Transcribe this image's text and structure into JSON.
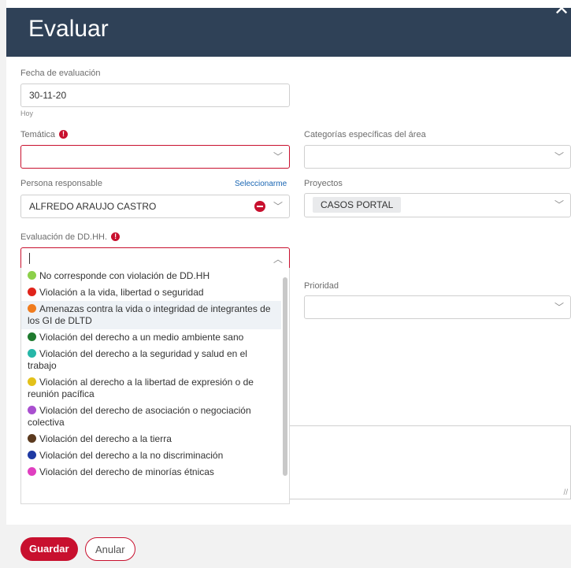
{
  "header": {
    "title": "Evaluar",
    "close_glyph": "✕"
  },
  "fecha": {
    "label": "Fecha de evaluación",
    "value": "30-11-20",
    "hint": "Hoy"
  },
  "tematica": {
    "label": "Temática",
    "value": ""
  },
  "categorias": {
    "label": "Categorías específicas del área",
    "value": ""
  },
  "persona": {
    "label": "Persona responsable",
    "link": "Seleccionarme",
    "value": "ALFREDO ARAUJO CASTRO"
  },
  "proyectos": {
    "label": "Proyectos",
    "tag": "CASOS PORTAL"
  },
  "evaluacion": {
    "label": "Evaluación de DD.HH.",
    "value": "",
    "options": [
      {
        "label": "No corresponde con violación de DD.HH",
        "color": "#8cd04a"
      },
      {
        "label": "Violación a la vida, libertad o seguridad",
        "color": "#e0241b"
      },
      {
        "label": "Amenazas contra la vida o integridad de integrantes de los GI de DLTD",
        "color": "#f07c1e"
      },
      {
        "label": "Violación del derecho a un medio ambiente sano",
        "color": "#1f7a2e"
      },
      {
        "label": "Violación del derecho a la seguridad y salud en el trabajo",
        "color": "#27b7a8"
      },
      {
        "label": "Violación al derecho a la libertad de expresión o de reunión pacífica",
        "color": "#e3c11a"
      },
      {
        "label": "Violación del derecho de asociación o negociación colectiva",
        "color": "#a94fcf"
      },
      {
        "label": "Violación del derecho a la tierra",
        "color": "#5b3a1e"
      },
      {
        "label": "Violación del derecho a la no discriminación",
        "color": "#1f3aa3"
      },
      {
        "label": "Violación del derecho de minorías étnicas",
        "color": "#e03fc0"
      }
    ]
  },
  "prioridad": {
    "label": "Prioridad",
    "value": ""
  },
  "footer": {
    "save_label": "Guardar",
    "cancel_label": "Anular"
  },
  "icons": {
    "chevron_down": "﹀",
    "chevron_up": "︿",
    "required": "!",
    "resize": "//"
  },
  "colors": {
    "header_bg": "#2f4157",
    "accent": "#c8102e"
  }
}
